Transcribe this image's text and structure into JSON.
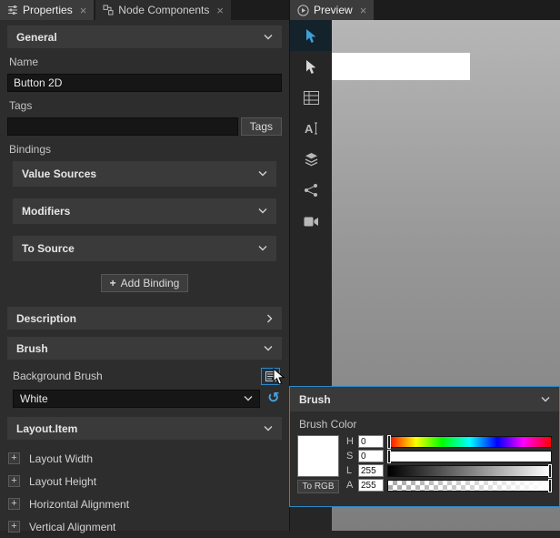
{
  "colors": {
    "accent_blue": "#2d89c9",
    "panel_bg": "#2d2d2d",
    "section_header_bg": "#3a3a3a",
    "input_bg": "#161616",
    "swatch_color": "#ffffff"
  },
  "left_panel": {
    "tabs": [
      {
        "label": "Properties"
      },
      {
        "label": "Node Components"
      }
    ],
    "general_section": "General",
    "name_label": "Name",
    "name_value": "Button 2D",
    "tags_label": "Tags",
    "tags_value": "",
    "tags_button": "Tags",
    "bindings_label": "Bindings",
    "value_sources_section": "Value Sources",
    "modifiers_section": "Modifiers",
    "to_source_section": "To Source",
    "add_binding_button": "Add Binding",
    "description_section": "Description",
    "brush_section": "Brush",
    "background_brush_label": "Background Brush",
    "background_brush_value": "White",
    "layout_item_section": "Layout.Item",
    "layout_rows": [
      {
        "label": "Layout Width"
      },
      {
        "label": "Layout Height"
      },
      {
        "label": "Horizontal Alignment"
      },
      {
        "label": "Vertical Alignment"
      }
    ]
  },
  "preview_panel": {
    "tab_label": "Preview"
  },
  "brush_popup": {
    "title": "Brush",
    "color_label": "Brush Color",
    "to_rgb_button": "To RGB",
    "channels": [
      {
        "label": "H",
        "value": "0"
      },
      {
        "label": "S",
        "value": "0"
      },
      {
        "label": "L",
        "value": "255"
      },
      {
        "label": "A",
        "value": "255"
      }
    ]
  }
}
